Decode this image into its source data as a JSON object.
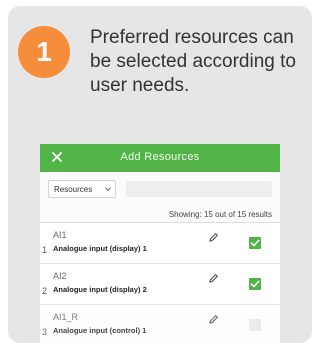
{
  "step": {
    "number": "1",
    "caption": "Preferred resources can be selected according to user needs."
  },
  "colors": {
    "badge": "#f58d3a",
    "header": "#52b447",
    "card": "#e6e6e6",
    "checkbox_checked": "#52b447"
  },
  "dialog": {
    "title": "Add Resources",
    "close_icon": "close-icon",
    "filter": {
      "selected": "Resources",
      "dropdown_icon": "chevron-down-icon"
    },
    "results": "Showing: 15 out of 15 results",
    "rows": [
      {
        "index": "1",
        "name": "AI1",
        "description": "Analogue input (display) 1",
        "edit_icon": "pencil-icon",
        "checked": true
      },
      {
        "index": "2",
        "name": "AI2",
        "description": "Analogue input (display) 2",
        "edit_icon": "pencil-icon",
        "checked": true
      },
      {
        "index": "3",
        "name": "AI1_R",
        "description": "Analogue input (control) 1",
        "edit_icon": "pencil-icon",
        "checked": false
      }
    ]
  }
}
